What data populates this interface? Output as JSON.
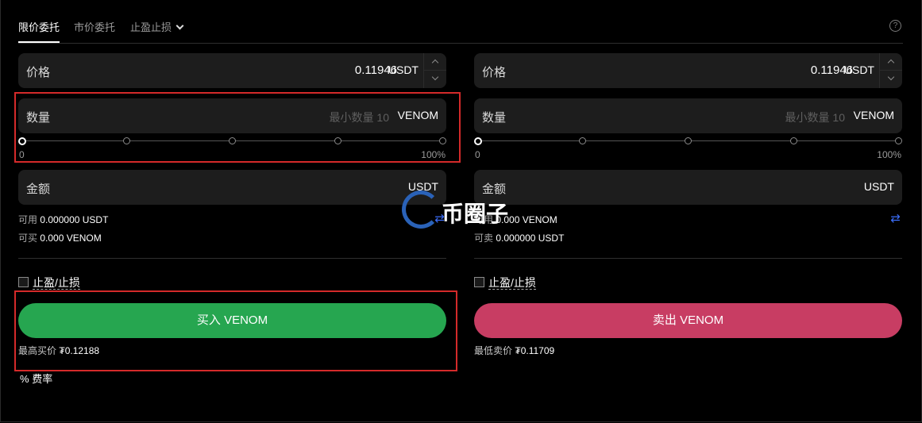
{
  "tabs": [
    {
      "label": "限价委托",
      "active": true
    },
    {
      "label": "市价委托",
      "active": false
    },
    {
      "label": "止盈止损",
      "active": false
    }
  ],
  "buy": {
    "price_label": "价格",
    "price_value": "0.11946",
    "price_unit": "USDT",
    "qty_label": "数量",
    "qty_placeholder": "最小数量 10",
    "qty_unit": "VENOM",
    "slider_min": "0",
    "slider_max": "100%",
    "slider_value_percent": 0,
    "amount_label": "金额",
    "amount_unit": "USDT",
    "available_label": "可用",
    "available_value": "0.000000 USDT",
    "can_trade_label": "可买",
    "can_trade_value": "0.000 VENOM",
    "tpsl_label": "止盈/止损",
    "button_label": "买入 VENOM",
    "best_label": "最高买价",
    "best_value": "₮0.12188"
  },
  "sell": {
    "price_label": "价格",
    "price_value": "0.11946",
    "price_unit": "USDT",
    "qty_label": "数量",
    "qty_placeholder": "最小数量 10",
    "qty_unit": "VENOM",
    "slider_min": "0",
    "slider_max": "100%",
    "slider_value_percent": 0,
    "amount_label": "金额",
    "amount_unit": "USDT",
    "available_label": "可用",
    "available_value": "0.000 VENOM",
    "can_trade_label": "可卖",
    "can_trade_value": "0.000000 USDT",
    "tpsl_label": "止盈/止损",
    "button_label": "卖出 VENOM",
    "best_label": "最低卖价",
    "best_value": "₮0.11709"
  },
  "fee_label": "费率",
  "watermark_text": "币圈子",
  "colors": {
    "buy": "#26a650",
    "sell": "#c83d63",
    "swap_icon": "#3a6cf6",
    "highlight": "#d42a2a"
  },
  "icons": {
    "help": "question-circle-icon",
    "swap": "swap-arrows-icon",
    "dropdown": "chevron-down-icon",
    "fee": "percent-icon"
  }
}
